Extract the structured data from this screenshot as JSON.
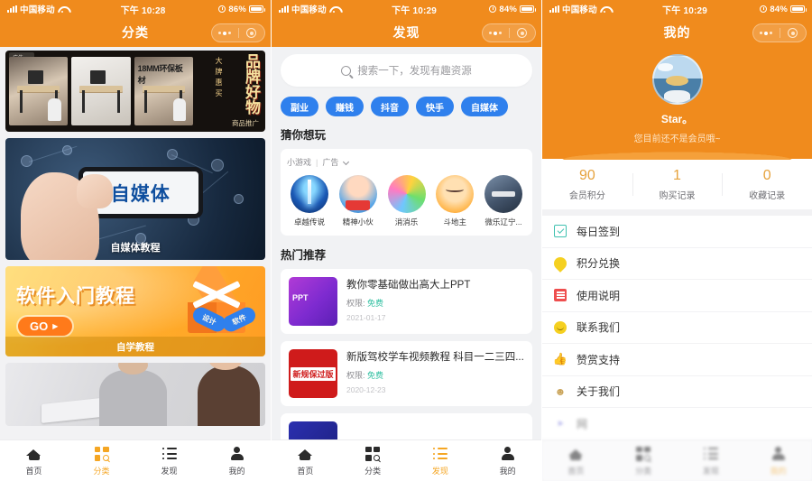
{
  "screens": [
    {
      "statusbar": {
        "carrier": "中国移动",
        "time": "下午 10:28",
        "battery": "86%"
      },
      "navbar": {
        "title": "分类"
      },
      "cards": [
        {
          "ad_badge": "广告",
          "mm_text": "18MM环保板材",
          "big_text": "品牌好物",
          "vert_text": "大牌惠买",
          "foot": "商品推广"
        },
        {
          "phone_text": "自媒体",
          "label": "自媒体教程"
        },
        {
          "title": "软件入门教程",
          "go": "GO",
          "cube_a": "设计",
          "cube_b": "软件",
          "label": "自学教程"
        }
      ],
      "tabs": [
        {
          "label": "首页",
          "icon": "home-icon",
          "active": false
        },
        {
          "label": "分类",
          "icon": "grid-icon",
          "active": true
        },
        {
          "label": "发现",
          "icon": "list-icon",
          "active": false
        },
        {
          "label": "我的",
          "icon": "user-icon",
          "active": false
        }
      ]
    },
    {
      "statusbar": {
        "carrier": "中国移动",
        "time": "下午 10:29",
        "battery": "84%"
      },
      "navbar": {
        "title": "发现"
      },
      "search": {
        "placeholder": "搜索一下，发现有趣资源",
        "value": "",
        "icon": "search-icon"
      },
      "tags": [
        "副业",
        "赚钱",
        "抖音",
        "快手",
        "自媒体"
      ],
      "games_section": {
        "title": "猜你想玩",
        "source": "小游戏",
        "ad_label": "广告",
        "games": [
          "卓越传说",
          "精神小伙",
          "消消乐",
          "斗地主",
          "微乐辽宁..."
        ]
      },
      "hot_section": {
        "title": "热门推荐",
        "items": [
          {
            "title": "教你零基础做出高大上PPT",
            "meta_label": "权限:",
            "meta_value": "免费",
            "date": "2021-01-17"
          },
          {
            "title": "新版驾校学车视频教程 科目一二三四...",
            "meta_label": "权限:",
            "meta_value": "免费",
            "date": "2020-12-23"
          },
          {
            "title": "",
            "meta_label": "",
            "meta_value": "",
            "date": ""
          }
        ]
      },
      "tabs": [
        {
          "label": "首页",
          "icon": "home-icon",
          "active": false
        },
        {
          "label": "分类",
          "icon": "grid-icon",
          "active": false
        },
        {
          "label": "发现",
          "icon": "list-icon",
          "active": true
        },
        {
          "label": "我的",
          "icon": "user-icon",
          "active": false
        }
      ]
    },
    {
      "statusbar": {
        "carrier": "中国移动",
        "time": "下午 10:29",
        "battery": "84%"
      },
      "navbar": {
        "title": "我的"
      },
      "profile": {
        "name": "Star。",
        "subtitle": "您目前还不是会员哦~"
      },
      "stats": [
        {
          "value": "90",
          "label": "会员积分"
        },
        {
          "value": "1",
          "label": "购买记录"
        },
        {
          "value": "0",
          "label": "收藏记录"
        }
      ],
      "menu": [
        {
          "label": "每日签到",
          "icon": "calendar-check-icon"
        },
        {
          "label": "积分兑换",
          "icon": "coin-icon"
        },
        {
          "label": "使用说明",
          "icon": "book-icon"
        },
        {
          "label": "联系我们",
          "icon": "smiley-icon"
        },
        {
          "label": "赞赏支持",
          "icon": "thumbs-up-icon"
        },
        {
          "label": "关于我们",
          "icon": "about-icon"
        }
      ],
      "tabs": [
        {
          "label": "首页",
          "icon": "home-icon",
          "active": false
        },
        {
          "label": "分类",
          "icon": "grid-icon",
          "active": false
        },
        {
          "label": "发现",
          "icon": "list-icon",
          "active": false
        },
        {
          "label": "我的",
          "icon": "user-icon",
          "active": true
        }
      ]
    }
  ],
  "colors": {
    "brand_orange": "#f08b1d",
    "tab_active": "#f5a623",
    "tag_blue": "#2f80ed",
    "free_green": "#2fbfa0"
  }
}
